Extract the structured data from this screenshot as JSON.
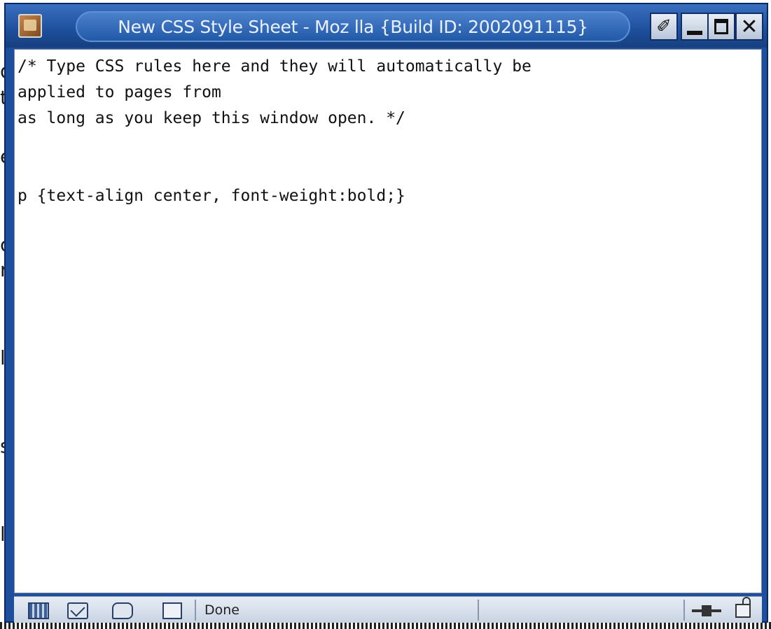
{
  "background_page": {
    "visible_fragments": [
      "d",
      "t",
      "e",
      "c",
      "r",
      "l",
      "s",
      "l"
    ]
  },
  "window": {
    "title": "New CSS Style Sheet - Moz lla {Build ID: 2002091115}",
    "buttons": {
      "pin": "✐",
      "close": "✕"
    }
  },
  "editor": {
    "content": "/* Type CSS rules here and they will automatically be\napplied to pages from\nas long as you keep this window open. */\n\n\np {text-align center, font-weight:bold;}"
  },
  "statusbar": {
    "status_text": "Done"
  },
  "colors": {
    "titlebar": "#1d4f9c",
    "title_text": "#eaf2ff",
    "editor_bg": "#ffffff",
    "statusbar_bg": "#c9d4e3"
  }
}
